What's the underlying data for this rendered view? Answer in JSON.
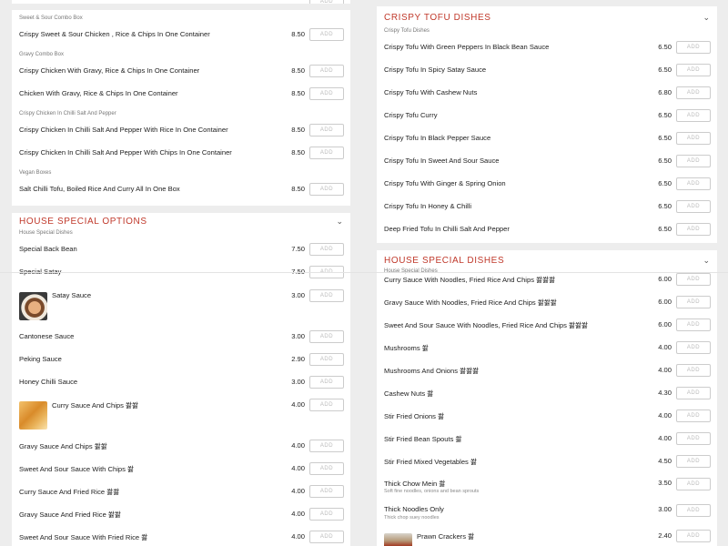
{
  "add_label": "ADD",
  "colors": {
    "accent": "#c0392b",
    "background": "#ededed"
  },
  "left": {
    "top_truncated_item": {
      "price": ""
    },
    "subheads": {
      "sweet_sour": "Sweet & Sour Combo Box",
      "gravy": "Gravy Combo Box",
      "chilli_salt": "Crispy Chicken In Chilli Salt And Pepper",
      "vegan": "Vegan Boxes",
      "house_special_dishes": "House Special Dishes"
    },
    "items": [
      {
        "name": "Crispy Sweet & Sour Chicken , Rice & Chips In One Container",
        "price": "8.50"
      },
      {
        "name": "Crispy Chicken With Gravy, Rice & Chips In One Container",
        "price": "8.50"
      },
      {
        "name": "Chicken With Gravy, Rice & Chips In One Container",
        "price": "8.50"
      },
      {
        "name": "Crispy Chicken In Chilli Salt And Pepper With Rice In One Container",
        "price": "8.50"
      },
      {
        "name": "Crispy Chicken In Chilli Salt And Pepper With Chips In One Container",
        "price": "8.50"
      },
      {
        "name": "Salt Chilli Tofu, Boiled Rice And Curry All In One Box",
        "price": "8.50"
      }
    ],
    "section_title": "House Special Options",
    "house_items": [
      {
        "name": "Special Back Bean",
        "price": "7.50"
      },
      {
        "name": "Special Satay",
        "price": "7.50"
      },
      {
        "name": "Satay Sauce",
        "price": "3.00"
      },
      {
        "name": "Cantonese Sauce",
        "price": "3.00"
      },
      {
        "name": "Peking Sauce",
        "price": "2.90"
      },
      {
        "name": "Honey Chilli Sauce",
        "price": "3.00"
      },
      {
        "name": "Curry Sauce And Chips 쐃쐃",
        "price": "4.00"
      },
      {
        "name": "Gravy Sauce And Chips 쐃쐃",
        "price": "4.00"
      },
      {
        "name": "Sweet And Sour Sauce With Chips 쐃",
        "price": "4.00"
      },
      {
        "name": "Curry Sauce And Fried Rice 쐃쐃",
        "price": "4.00"
      },
      {
        "name": "Gravy Sauce And Fried Rice 쐃쐃",
        "price": "4.00"
      },
      {
        "name": "Sweet And Sour Sauce With Fried Rice 쐃",
        "price": "4.00"
      }
    ]
  },
  "right": {
    "section_title": "Crispy Tofu Dishes",
    "subhead": "Crispy Tofu Dishes",
    "items": [
      {
        "name": "Crispy Tofu With Green Peppers In Black Bean Sauce",
        "price": "6.50"
      },
      {
        "name": "Crispy Tofu In Spicy Satay Sauce",
        "price": "6.50"
      },
      {
        "name": "Crispy Tofu With Cashew Nuts",
        "price": "6.80"
      },
      {
        "name": "Crispy Tofu Curry",
        "price": "6.50"
      },
      {
        "name": "Crispy Tofu In Black Pepper Sauce",
        "price": "6.50"
      },
      {
        "name": "Crispy Tofu In Sweet And Sour Sauce",
        "price": "6.50"
      },
      {
        "name": "Crispy Tofu With Ginger & Spring Onion",
        "price": "6.50"
      },
      {
        "name": "Crispy Tofu In Honey & Chilli",
        "price": "6.50"
      },
      {
        "name": "Deep Fried Tofu In Chilli Salt And Pepper",
        "price": "6.50"
      }
    ],
    "section2_title": "House Special Dishes",
    "section2_subhead": "House Special Dishes",
    "house_items": [
      {
        "name": "Curry Sauce With Noodles, Fried Rice And Chips 쐃쐃쐃",
        "price": "6.00"
      },
      {
        "name": "Gravy Sauce With Noodles, Fried Rice And Chips 쐃쐃쐃",
        "price": "6.00"
      },
      {
        "name": "Sweet And Sour Sauce With Noodles, Fried Rice And Chips 쐃쐃쐃",
        "price": "6.00"
      },
      {
        "name": "Mushrooms 쐃",
        "price": "4.00"
      },
      {
        "name": "Mushrooms And Onions 쐃쐃쐃",
        "price": "4.00"
      },
      {
        "name": "Cashew Nuts 쐃",
        "price": "4.30"
      },
      {
        "name": "Stir Fried Onions 쐃",
        "price": "4.00"
      },
      {
        "name": "Stir Fried Bean Spouts 쐃",
        "price": "4.00"
      },
      {
        "name": "Stir Fried Mixed Vegetables 쐃",
        "price": "4.50"
      },
      {
        "name": "Thick Chow Mein 쐃",
        "desc": "Soft fine noodles, onions and bean sprouts",
        "price": "3.50"
      },
      {
        "name": "Thick Noodles Only",
        "desc": "Thick chop suey noodles",
        "price": "3.00"
      },
      {
        "name": "Prawn Crackers 쐃",
        "price": "2.40"
      }
    ]
  }
}
